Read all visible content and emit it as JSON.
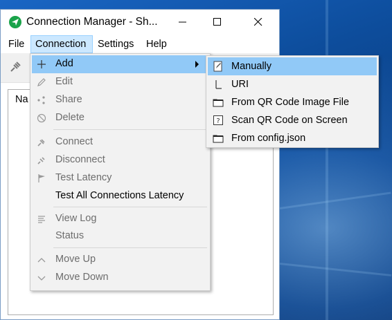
{
  "window": {
    "title": "Connection Manager - Sh..."
  },
  "menubar": {
    "items": [
      "File",
      "Connection",
      "Settings",
      "Help"
    ],
    "active": "Connection"
  },
  "list": {
    "header": "Na"
  },
  "connection_menu": {
    "items": [
      {
        "label": "Add",
        "icon": "plus-icon",
        "enabled": true,
        "highlighted": true,
        "submenu": true
      },
      {
        "label": "Edit",
        "icon": "pencil-icon",
        "enabled": false
      },
      {
        "label": "Share",
        "icon": "share-icon",
        "enabled": false
      },
      {
        "label": "Delete",
        "icon": "prohibited-icon",
        "enabled": false
      },
      {
        "label": "Connect",
        "icon": "plug-icon",
        "enabled": false
      },
      {
        "label": "Disconnect",
        "icon": "unplug-icon",
        "enabled": false
      },
      {
        "label": "Test Latency",
        "icon": "flag-icon",
        "enabled": false
      },
      {
        "label": "Test All Connections Latency",
        "icon": "",
        "enabled": true
      },
      {
        "label": "View Log",
        "icon": "log-icon",
        "enabled": false
      },
      {
        "label": "Status",
        "icon": "",
        "enabled": false
      },
      {
        "label": "Move Up",
        "icon": "chevron-up-icon",
        "enabled": false
      },
      {
        "label": "Move Down",
        "icon": "chevron-down-icon",
        "enabled": false
      }
    ]
  },
  "add_submenu": {
    "items": [
      {
        "label": "Manually",
        "icon": "edit-document-icon",
        "highlighted": true
      },
      {
        "label": "URI",
        "icon": "text-cursor-icon"
      },
      {
        "label": "From QR Code Image File",
        "icon": "folder-icon"
      },
      {
        "label": "Scan QR Code on Screen",
        "icon": "question-box-icon"
      },
      {
        "label": "From config.json",
        "icon": "folder-icon"
      }
    ]
  },
  "colors": {
    "highlight": "#91c9f7",
    "menu_active": "#cce8ff",
    "app_icon": "#1aa34a",
    "disabled_text": "#6d6d6d"
  }
}
